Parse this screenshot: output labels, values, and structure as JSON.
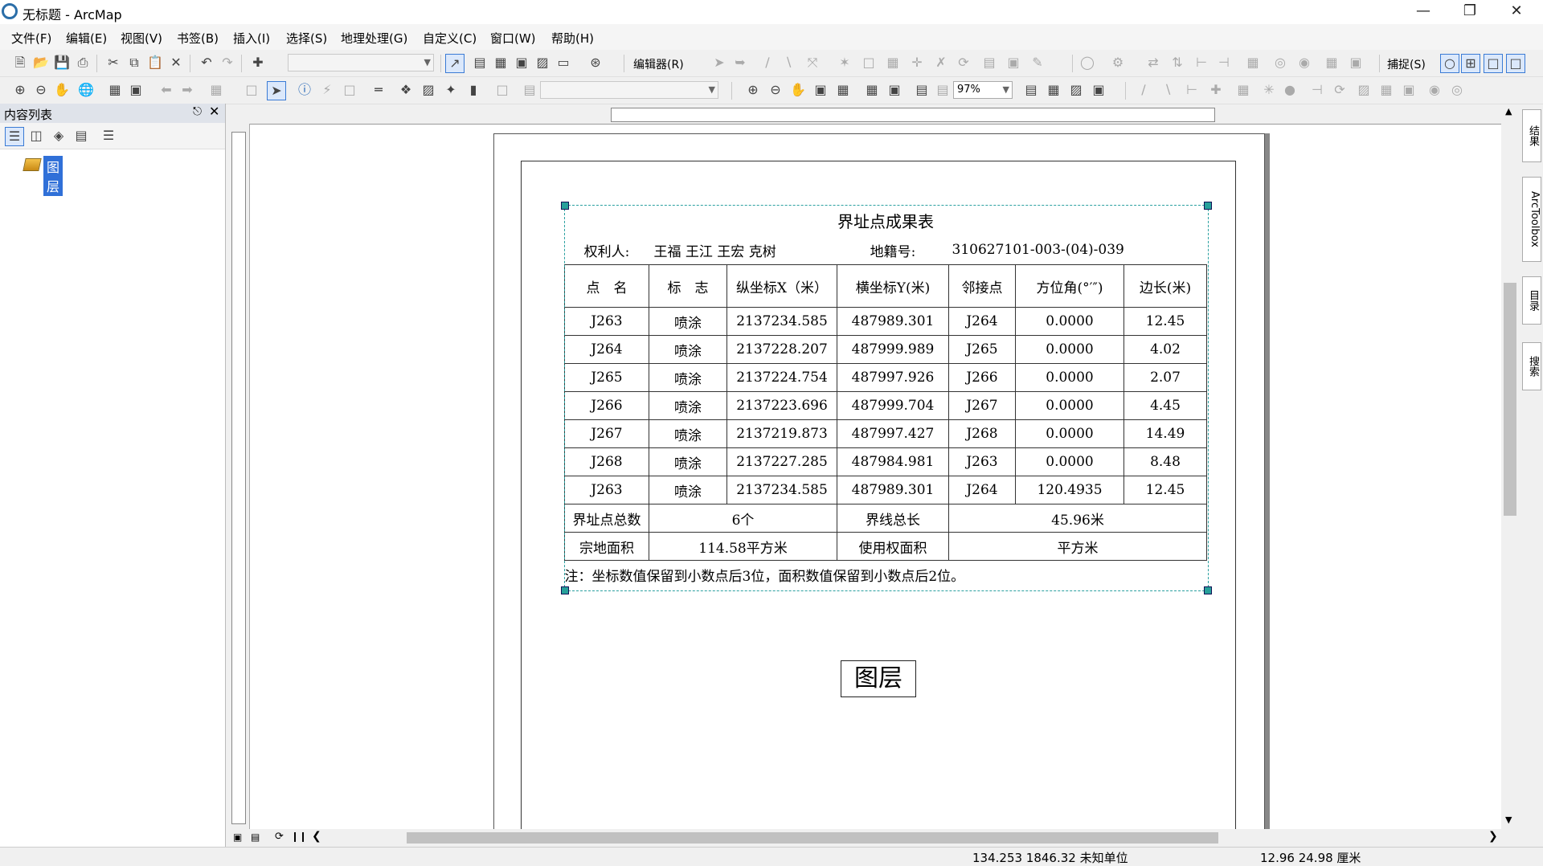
{
  "window": {
    "title": "无标题 - ArcMap"
  },
  "menu": [
    "文件(F)",
    "编辑(E)",
    "视图(V)",
    "书签(B)",
    "插入(I)",
    "选择(S)",
    "地理处理(G)",
    "自定义(C)",
    "窗口(W)",
    "帮助(H)"
  ],
  "toolbar": {
    "editor_label": "编辑器(R)",
    "snap_label": "捕捉(S)",
    "zoom_value": "97%"
  },
  "toc": {
    "title": "内容列表",
    "layer": "图层"
  },
  "table": {
    "title": "界址点成果表",
    "owner_label": "权利人:",
    "owner_value": "王福 王江 王宏 克树",
    "parcel_label": "地籍号:",
    "parcel_value": "310627101-003-(04)-039",
    "headers": [
      "点　名",
      "标　志",
      "纵坐标X（米）",
      "横坐标Y(米)",
      "邻接点",
      "方位角(°′″)",
      "边长(米)"
    ],
    "rows": [
      [
        "J263",
        "喷涂",
        "2137234.585",
        "487989.301",
        "J264",
        "0.0000",
        "12.45"
      ],
      [
        "J264",
        "喷涂",
        "2137228.207",
        "487999.989",
        "J265",
        "0.0000",
        "4.02"
      ],
      [
        "J265",
        "喷涂",
        "2137224.754",
        "487997.926",
        "J266",
        "0.0000",
        "2.07"
      ],
      [
        "J266",
        "喷涂",
        "2137223.696",
        "487999.704",
        "J267",
        "0.0000",
        "4.45"
      ],
      [
        "J267",
        "喷涂",
        "2137219.873",
        "487997.427",
        "J268",
        "0.0000",
        "14.49"
      ],
      [
        "J268",
        "喷涂",
        "2137227.285",
        "487984.981",
        "J263",
        "0.0000",
        "8.48"
      ],
      [
        "J263",
        "喷涂",
        "2137234.585",
        "487989.301",
        "J264",
        "120.4935",
        "12.45"
      ]
    ],
    "count_label": "界址点总数",
    "count_value": "6个",
    "length_label": "界线总长",
    "length_value": "45.96米",
    "area_label": "宗地面积",
    "area_value": "114.58平方米",
    "use_area_label": "使用权面积",
    "use_area_value": "平方米",
    "note": "注：坐标数值保留到小数点后3位，面积数值保留到小数点后2位。"
  },
  "legend_text": "图层",
  "dock_tabs": [
    "结果",
    "ArcToolbox",
    "目录",
    "搜索"
  ],
  "status": {
    "coords": "134.253  1846.32 未知单位",
    "page_coords": "12.96  24.98 厘米"
  }
}
